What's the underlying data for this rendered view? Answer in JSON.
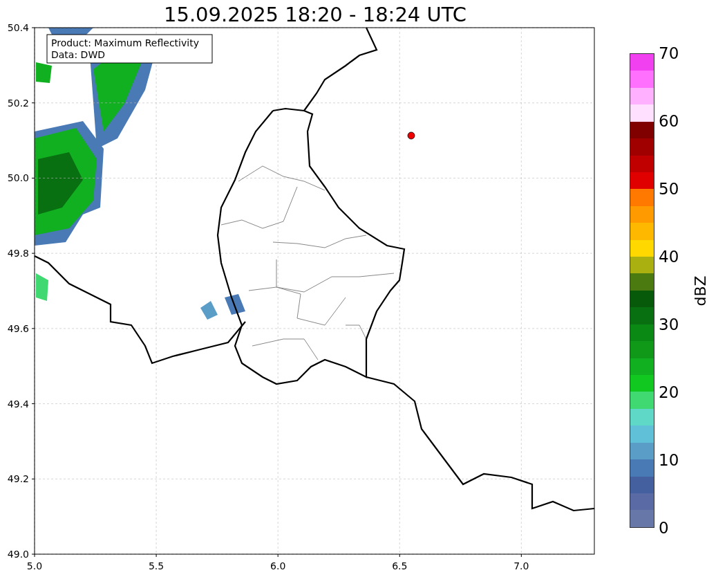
{
  "title": "15.09.2025 18:20 - 18:24 UTC",
  "legend": [
    "Product: Maximum Reflectivity",
    "Data: DWD"
  ],
  "x_ticks": [
    "5.0",
    "5.5",
    "6.0",
    "6.5",
    "7.0"
  ],
  "y_ticks": [
    "50.4",
    "50.2",
    "50.0",
    "49.8",
    "49.6",
    "49.4",
    "49.2",
    "49.0"
  ],
  "colorbar": {
    "label": "dBZ",
    "ticks": [
      "70",
      "60",
      "50",
      "40",
      "30",
      "20",
      "10",
      "0"
    ],
    "bands": [
      {
        "color": "#f040f0"
      },
      {
        "color": "#ff70ff"
      },
      {
        "color": "#ffb0ff"
      },
      {
        "color": "#ffe0ff"
      },
      {
        "color": "#800000"
      },
      {
        "color": "#a00000"
      },
      {
        "color": "#c00000"
      },
      {
        "color": "#e00000"
      },
      {
        "color": "#ff7800"
      },
      {
        "color": "#ff9a00"
      },
      {
        "color": "#ffb800"
      },
      {
        "color": "#ffd800"
      },
      {
        "color": "#aab010"
      },
      {
        "color": "#4a7a10"
      },
      {
        "color": "#065a0a"
      },
      {
        "color": "#087010"
      },
      {
        "color": "#0a8a14"
      },
      {
        "color": "#109818"
      },
      {
        "color": "#10b020"
      },
      {
        "color": "#10c820"
      },
      {
        "color": "#40d870"
      },
      {
        "color": "#60d8c8"
      },
      {
        "color": "#60c0d8"
      },
      {
        "color": "#5a9ec8"
      },
      {
        "color": "#4a7ab5"
      },
      {
        "color": "#44609e"
      },
      {
        "color": "#5a6aa5"
      },
      {
        "color": "#6677a8"
      }
    ]
  }
}
